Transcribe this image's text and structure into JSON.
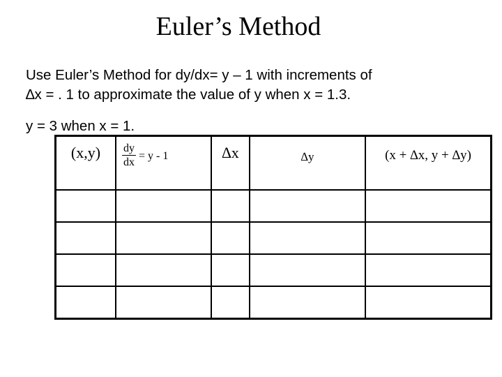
{
  "title": "Euler’s Method",
  "problem": {
    "line1": "Use Euler’s Method for dy/dx= y – 1 with increments of",
    "line2": "∆x = . 1 to approximate the value of y when x = 1.3.",
    "line3": "y = 3 when x = 1."
  },
  "table": {
    "headers": {
      "point": "(x,y)",
      "slope_num": "dy",
      "slope_den": "dx",
      "slope_rhs": "= y - 1",
      "delta_x": "∆x",
      "delta_y": "∆y",
      "next_point": "(x + ∆x, y + ∆y)"
    },
    "rows": [
      [
        "",
        "",
        "",
        "",
        ""
      ],
      [
        "",
        "",
        "",
        "",
        ""
      ],
      [
        "",
        "",
        "",
        "",
        ""
      ],
      [
        "",
        "",
        "",
        "",
        ""
      ]
    ]
  }
}
